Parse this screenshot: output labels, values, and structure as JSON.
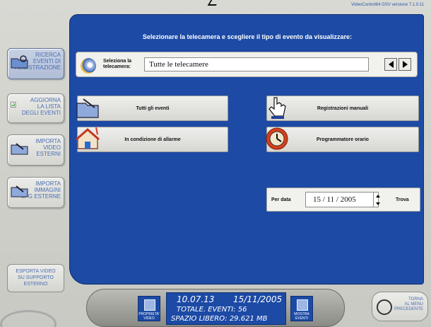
{
  "version": "VideoControl64 GSV versione 7.1.0.11",
  "sidebar": {
    "items": [
      {
        "label_lines": [
          "RICERCA",
          "EVENTI DI",
          "REGISTRAZIONE"
        ]
      },
      {
        "label_lines": [
          "AGGIORNA",
          "LA LISTA",
          "DEGLI EVENTI"
        ]
      },
      {
        "label_lines": [
          "IMPORTA",
          "VIDEO",
          "ESTERNI"
        ]
      },
      {
        "label_lines": [
          "IMPORTA",
          "IMMAGINI",
          "JPG ESTERNE"
        ]
      }
    ],
    "export_lines": [
      "ESPORTA VIDEO",
      "SU SUPPORTO",
      "ESTERNO"
    ]
  },
  "main": {
    "title": "Selezionare la telecamera e scegliere il tipo di evento da visualizzare:",
    "camera_label_lines": [
      "Seleziona la",
      "telecamera:"
    ],
    "camera_value": "Tutte le telecamere",
    "events": [
      {
        "label": "Tutti gli eventi"
      },
      {
        "label": "Registrazioni manuali"
      },
      {
        "label": "In condizione di allarme"
      },
      {
        "label": "Programmatore orario"
      }
    ],
    "date_label": "Per data",
    "date_value": "15 / 11 / 2005",
    "date_go": "Trova"
  },
  "bottom": {
    "left_btn_lines": [
      "PROPRIETA'",
      "VIDEO"
    ],
    "right_btn_lines": [
      "MOSTRA",
      "EVENTI"
    ],
    "time": "10.07.13",
    "date": "15/11/2005",
    "total": "TOTALE. EVENTI: 56",
    "space": "SPAZIO LIBERO: 29.621 MB",
    "back_lines": [
      "TORNA",
      "AL MENU",
      "PRECEDENTE"
    ]
  },
  "colors": {
    "panel": "#1c4aa5",
    "accent_text": "#4a6fb0"
  }
}
